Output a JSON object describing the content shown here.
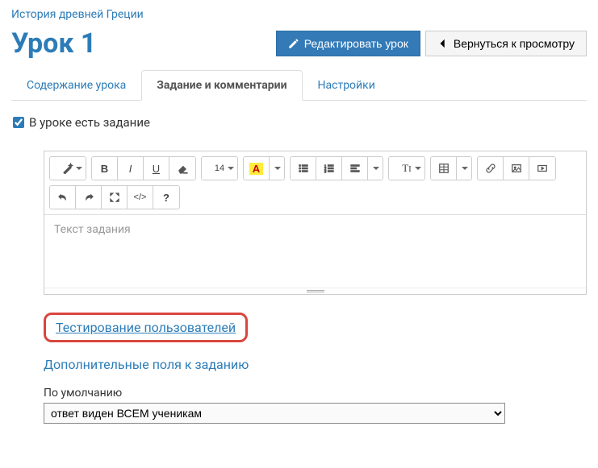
{
  "breadcrumb": "История древней Греции",
  "title": "Урок 1",
  "buttons": {
    "edit": "Редактировать урок",
    "back": "Вернуться к просмотру"
  },
  "tabs": [
    "Содержание урока",
    "Задание и комментарии",
    "Настройки"
  ],
  "has_task_label": "В уроке есть задание",
  "editor": {
    "placeholder": "Текст задания",
    "font_size": "14"
  },
  "links": {
    "user_testing": "Тестирование пользователей",
    "extra_fields": "Дополнительные поля к заданию"
  },
  "visibility": {
    "label": "По умолчанию",
    "selected": "ответ виден ВСЕМ ученикам",
    "options": [
      "ответ виден ВСЕМ ученикам"
    ]
  }
}
